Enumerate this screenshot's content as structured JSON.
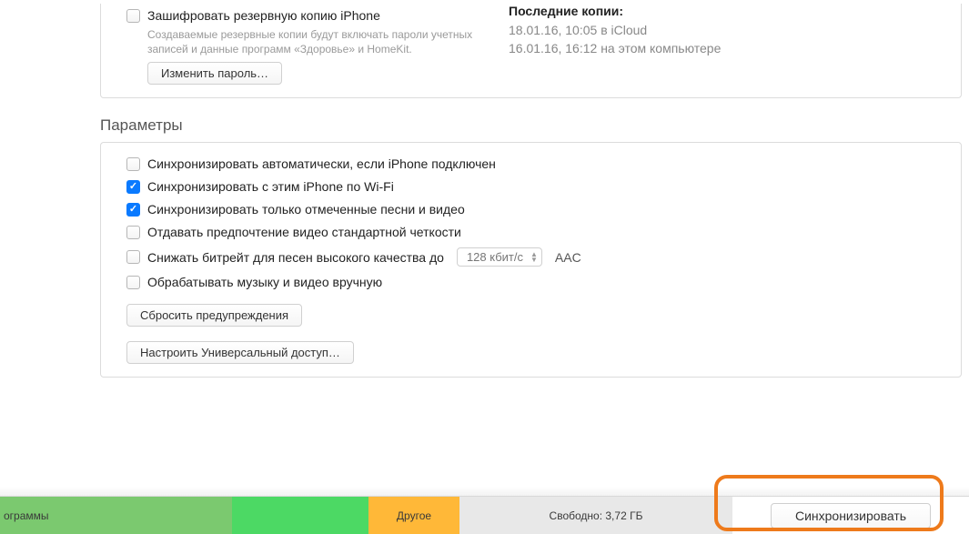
{
  "backup": {
    "encrypt_label": "Зашифровать резервную копию iPhone",
    "encrypt_sub": "Создаваемые резервные копии будут включать пароли учетных записей и данные программ «Здоровье» и HomeKit.",
    "change_password_btn": "Изменить пароль…",
    "last_copies_title": "Последние копии:",
    "copy1": "18.01.16, 10:05 в iCloud",
    "copy2": "16.01.16, 16:12 на этом компьютере"
  },
  "options": {
    "title": "Параметры",
    "auto_sync": "Синхронизировать автоматически, если iPhone подключен",
    "wifi_sync": "Синхронизировать с этим iPhone по Wi-Fi",
    "checked_only": "Синхронизировать только отмеченные песни и видео",
    "prefer_sd": "Отдавать предпочтение видео стандартной четкости",
    "reduce_bitrate": "Снижать битрейт для песен высокого качества до",
    "bitrate_value": "128 кбит/с",
    "bitrate_suffix": "AAC",
    "manual_manage": "Обрабатывать музыку и видео вручную",
    "reset_warnings_btn": "Сбросить предупреждения",
    "universal_access_btn": "Настроить Универсальный доступ…"
  },
  "footer": {
    "apps_label": "ограммы",
    "other_label": "Другое",
    "free_label": "Свободно: 3,72 ГБ",
    "sync_btn": "Синхронизировать"
  }
}
